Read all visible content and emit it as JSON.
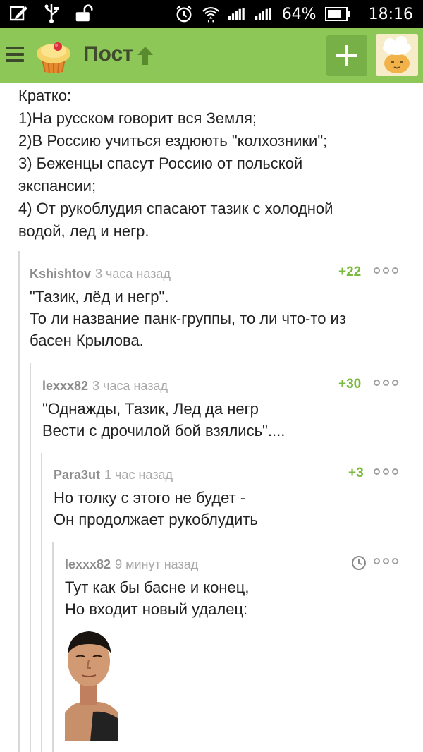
{
  "status_bar": {
    "battery": "64%",
    "time": "18:16"
  },
  "app_bar": {
    "title": "Пост"
  },
  "post": {
    "lines": [
      "Кратко:",
      "1)На русском говорит вся Земля;",
      "2)В Россию учиться ездюють \"колхозники\";",
      "3) Беженцы спасут Россию от польской",
      "экспансии;",
      "4) От рукоблудия спасают тазик с холодной",
      "водой, лед и негр."
    ]
  },
  "comments": [
    {
      "author": "Kshishtov",
      "time": "3 часа назад",
      "rating": "+22",
      "lines": [
        "\"Тазик, лёд и негр\".",
        "То ли название панк-группы, то ли что-то из",
        "басен Крылова."
      ]
    },
    {
      "author": "lexxx82",
      "time": "3 часа назад",
      "rating": "+30",
      "lines": [
        "\"Однажды, Тазик, Лед да негр",
        "Вести с дрочилой бой взялись\"...."
      ]
    },
    {
      "author": "Para3ut",
      "time": "1 час назад",
      "rating": "+3",
      "lines": [
        "Но толку с этого не будет -",
        "Он продолжает рукоблудить"
      ]
    },
    {
      "author": "lexxx82",
      "time": "9 минут назад",
      "rating": "",
      "lines": [
        "Тут как бы басне и конец,",
        "Но входит новый удалец:"
      ]
    }
  ]
}
